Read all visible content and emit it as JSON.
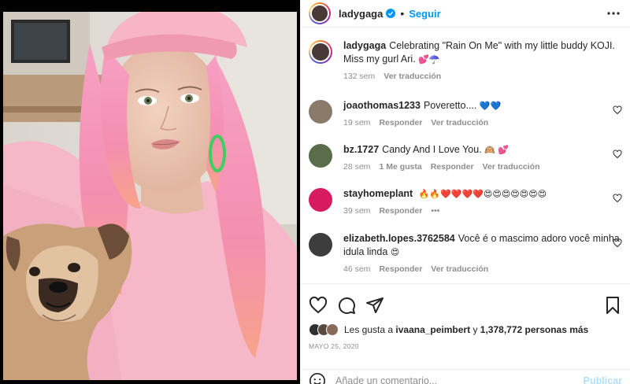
{
  "post": {
    "author": "ladygaga",
    "follow_label": "Seguir",
    "dot": "•"
  },
  "caption": {
    "username": "ladygaga",
    "text": "Celebrating \"Rain On Me\" with my little buddy KOJI. Miss my gurl Ari.",
    "emoji": "💕☂️",
    "time": "132 sem",
    "translate": "Ver traducción"
  },
  "comments": [
    {
      "username": "joaothomas1233",
      "text": "Poveretto....",
      "emoji": "💙💙",
      "time": "19 sem",
      "likes": "",
      "reply": "Responder",
      "translate": "Ver traducción",
      "avatar_color": "#8a7a6a"
    },
    {
      "username": "bz.1727",
      "text": "Candy And I Love You.",
      "emoji": "🙉 💕",
      "time": "28 sem",
      "likes": "1 Me gusta",
      "reply": "Responder",
      "translate": "Ver traducción",
      "avatar_color": "#5a6d4a"
    },
    {
      "username": "stayhomeplant",
      "text": "",
      "emoji": "🔥🔥❤️❤️❤️❤️😍😍😍😍😍😍😍",
      "time": "39 sem",
      "likes": "",
      "reply": "Responder",
      "translate": "•••",
      "avatar_color": "#d81b60"
    },
    {
      "username": "elizabeth.lopes.3762584",
      "text": "Você é o mascimo adoro você minha idula linda",
      "emoji": "😍",
      "time": "46 sem",
      "likes": "",
      "reply": "Responder",
      "translate": "Ver traducción",
      "avatar_color": "#3d3d3d"
    }
  ],
  "likes": {
    "prefix": "Les gusta a",
    "user": "ivaana_peimbert",
    "suffix": "y",
    "count": "1,378,772 personas más"
  },
  "date": "Mayo 25, 2020",
  "add_comment": {
    "placeholder": "Añade un comentario...",
    "post_label": "Publicar"
  },
  "colors": {
    "accent": "#0095f6",
    "hair": "#f48fb1",
    "cap": "#f7b6c2",
    "sweater": "#f6b8c8"
  }
}
